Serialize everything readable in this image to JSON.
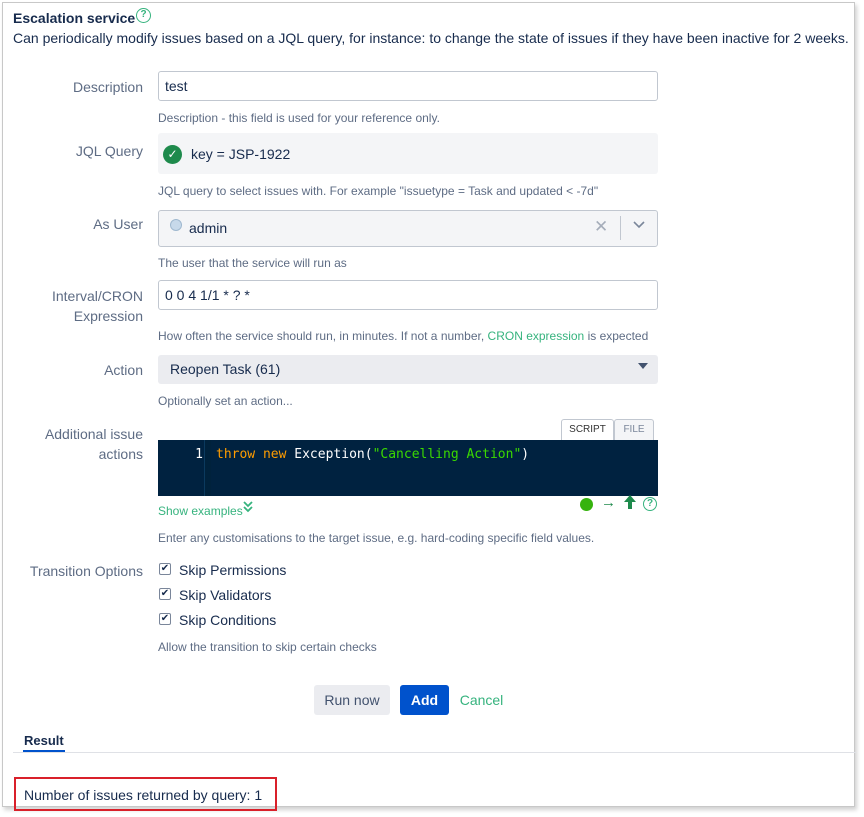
{
  "header": {
    "title": "Escalation service",
    "help_icon": "question-circle-icon",
    "subtitle": "Can periodically modify issues based on a JQL query, for instance: to change the state of issues if they have been inactive for 2 weeks."
  },
  "form": {
    "description": {
      "label": "Description",
      "value": "test",
      "help": "Description - this field is used for your reference only."
    },
    "jql": {
      "label": "JQL Query",
      "value": "key = JSP-1922",
      "valid_icon": "check-circle-icon",
      "help": "JQL query to select issues with. For example \"issuetype = Task and updated < -7d\""
    },
    "as_user": {
      "label": "As User",
      "value": "admin",
      "help": "The user that the service will run as"
    },
    "interval": {
      "label_line1": "Interval/CRON",
      "label_line2": "Expression",
      "value": "0 0 4 1/1 * ? *",
      "help_before": "How often the service should run, in minutes. If not a number,",
      "help_link": "CRON expression",
      "help_after": "is expected"
    },
    "action": {
      "label": "Action",
      "selected": "Reopen Task (61)",
      "help": "Optionally set an action..."
    },
    "additional_actions": {
      "label_line1": "Additional issue",
      "label_line2": "actions",
      "tab_script": "SCRIPT",
      "tab_file": "FILE",
      "line_number": "1",
      "code_keyword1": "throw",
      "code_keyword2": "new",
      "code_class": "Exception(",
      "code_string": "\"Cancelling Action\"",
      "code_end": ")",
      "show_examples": "Show examples",
      "help": "Enter any customisations to the target issue, e.g. hard-coding specific field values."
    },
    "transition_options": {
      "label": "Transition Options",
      "options": [
        {
          "label": "Skip Permissions",
          "checked": true
        },
        {
          "label": "Skip Validators",
          "checked": true
        },
        {
          "label": "Skip Conditions",
          "checked": true
        }
      ],
      "help": "Allow the transition to skip certain checks"
    }
  },
  "buttons": {
    "run_now": "Run now",
    "add": "Add",
    "cancel": "Cancel"
  },
  "result": {
    "tab": "Result",
    "text": "Number of issues returned by query: 1"
  },
  "colors": {
    "accent_green": "#36b37e",
    "primary_blue": "#0052cc",
    "highlight_red": "#d9202a",
    "editor_bg": "#002240"
  }
}
